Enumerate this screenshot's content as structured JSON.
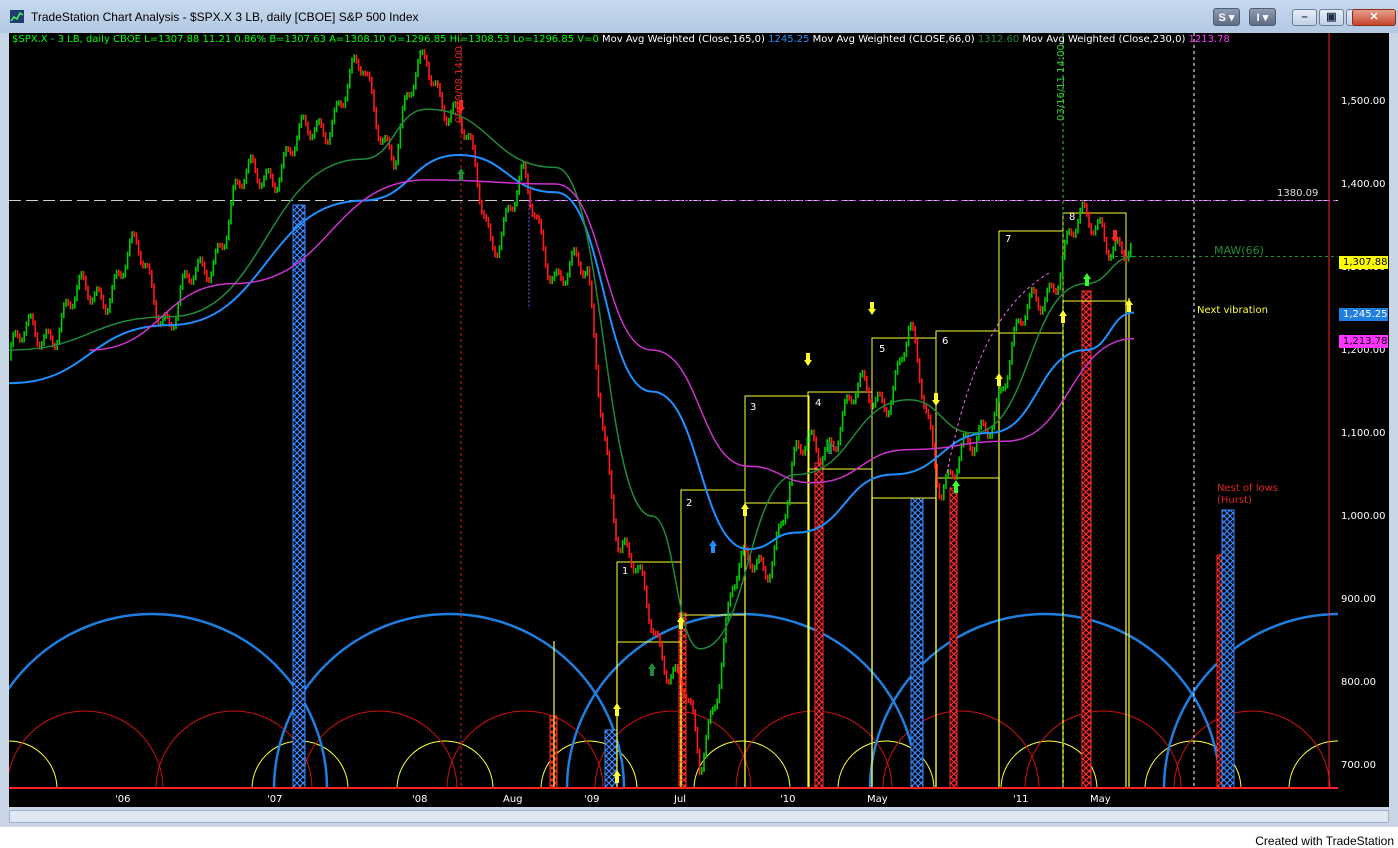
{
  "window": {
    "title": "TradeStation Chart Analysis - $SPX.X 3 LB, daily [CBOE] S&P 500 Index",
    "btn_s": "S",
    "btn_i": "I",
    "credit": "Created with TradeStation"
  },
  "info_line": {
    "symbol": "$SPX.X - 3 LB, daily  CBOE  L=1307.88  11.21  0.86%  B=1307.63  A=1308.10  O=1296.85  Hi=1308.53  Lo=1296.85  V=0",
    "ma1_label": "  Mov Avg Weighted (Close,165,0)  ",
    "ma1_value": "1245.25",
    "ma2_label": "  Mov Avg Weighted (CLOSE,66,0)  ",
    "ma2_value": "1312.60",
    "ma3_label": "  Mov Avg Weighted (Close,230,0)  ",
    "ma3_value": "1213.78"
  },
  "colors": {
    "up_bar": "#00cc00",
    "down_bar": "#ff1a1a",
    "ma165": "#1e90ff",
    "ma66": "#1f8a3a",
    "ma230": "#cc33cc",
    "box": "#ffff33",
    "cycle_blue": "#1e7fe0",
    "cycle_red": "#cc1111",
    "cycle_yellow": "#ffff33"
  },
  "price_axis": {
    "ticks": [
      "1,500.00",
      "1,400.00",
      "1,300.00",
      "1,200.00",
      "1,100.00",
      "1,000.00",
      "900.00",
      "800.00",
      "700.00"
    ],
    "badge_last": "1,307.88",
    "badge_ma165": "1,245.25",
    "badge_ma230": "1,213.78"
  },
  "time_axis": {
    "labels": [
      "'06",
      "'07",
      "'08",
      "Aug",
      "'09",
      "Jul",
      "'10",
      "May",
      "'11",
      "May"
    ]
  },
  "annotations": {
    "level_1380": "1380.09",
    "maw66": "MAW(66)",
    "next_vibration": "Next vibration",
    "nest_of_lows_1": "Nest of lows",
    "nest_of_lows_2": "(Hurst)",
    "date_left": "05/19/08 14:00",
    "date_right": "03/16/11 14:00",
    "box_numbers": [
      "1",
      "2",
      "3",
      "4",
      "5",
      "6",
      "7",
      "8"
    ]
  },
  "chart_data": {
    "type": "bar",
    "title": "$SPX.X - 3 LB, daily",
    "ylim": [
      670,
      1600
    ],
    "grid": false,
    "series": [
      {
        "name": "$SPX.X 3 LB",
        "x": [
          "2005-08",
          "2005-10",
          "2005-12",
          "2006-02",
          "2006-04",
          "2006-06",
          "2006-08",
          "2006-10",
          "2006-12",
          "2007-02",
          "2007-04",
          "2007-06",
          "2007-08",
          "2007-10",
          "2007-12",
          "2008-02",
          "2008-04",
          "2008-06",
          "2008-08",
          "2008-10",
          "2008-12",
          "2009-02",
          "2009-03",
          "2009-05",
          "2009-07",
          "2009-09",
          "2009-11",
          "2010-01",
          "2010-03",
          "2010-04",
          "2010-06",
          "2010-08",
          "2010-10",
          "2010-12",
          "2011-02",
          "2011-04",
          "2011-06"
        ],
        "values": [
          1190,
          1225,
          1250,
          1280,
          1310,
          1240,
          1290,
          1380,
          1420,
          1440,
          1490,
          1530,
          1440,
          1555,
          1470,
          1340,
          1390,
          1300,
          1280,
          960,
          880,
          780,
          690,
          920,
          940,
          1060,
          1100,
          1140,
          1160,
          1210,
          1050,
          1070,
          1180,
          1260,
          1330,
          1360,
          1295
        ]
      },
      {
        "name": "Mov Avg Weighted (Close,165,0)",
        "x": [
          "2005-08",
          "2006-06",
          "2007-06",
          "2007-12",
          "2008-06",
          "2008-12",
          "2009-06",
          "2009-09",
          "2010-03",
          "2010-09",
          "2011-03",
          "2011-06"
        ],
        "values": [
          1160,
          1230,
          1380,
          1435,
          1390,
          1150,
          960,
          980,
          1050,
          1100,
          1200,
          1245.25
        ]
      },
      {
        "name": "Mov Avg Weighted (CLOSE,66,0)",
        "x": [
          "2005-08",
          "2006-06",
          "2007-06",
          "2007-10",
          "2008-06",
          "2008-12",
          "2009-03",
          "2009-09",
          "2010-04",
          "2010-08",
          "2011-03",
          "2011-06"
        ],
        "values": [
          1200,
          1240,
          1430,
          1490,
          1420,
          1000,
          840,
          1050,
          1140,
          1100,
          1280,
          1312.6
        ]
      },
      {
        "name": "Mov Avg Weighted (Close,230,0)",
        "x": [
          "2006-01",
          "2006-10",
          "2007-10",
          "2008-06",
          "2008-12",
          "2009-06",
          "2009-10",
          "2010-04",
          "2010-10",
          "2011-06"
        ],
        "values": [
          1200,
          1280,
          1405,
          1400,
          1200,
          1060,
          1040,
          1080,
          1090,
          1213.78
        ]
      }
    ]
  }
}
